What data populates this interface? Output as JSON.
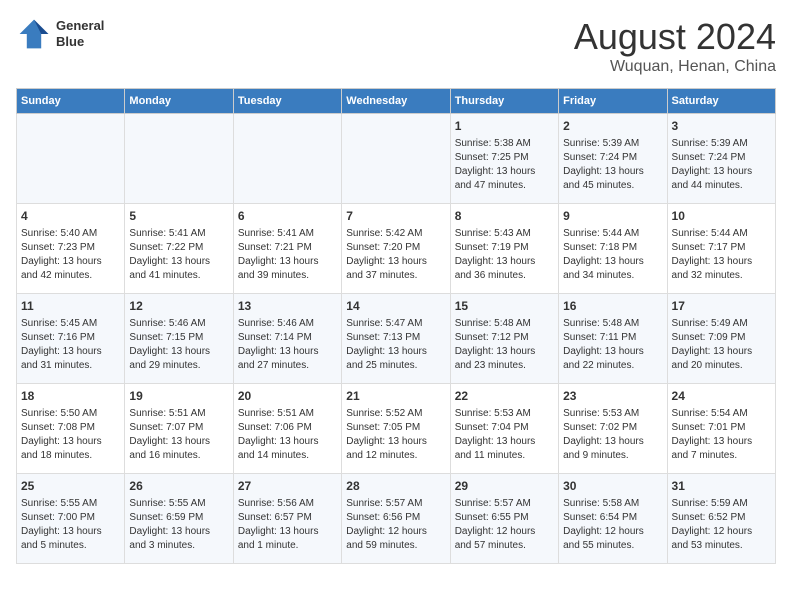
{
  "header": {
    "logo_line1": "General",
    "logo_line2": "Blue",
    "main_title": "August 2024",
    "subtitle": "Wuquan, Henan, China"
  },
  "days_of_week": [
    "Sunday",
    "Monday",
    "Tuesday",
    "Wednesday",
    "Thursday",
    "Friday",
    "Saturday"
  ],
  "weeks": [
    [
      {
        "day": "",
        "info": ""
      },
      {
        "day": "",
        "info": ""
      },
      {
        "day": "",
        "info": ""
      },
      {
        "day": "",
        "info": ""
      },
      {
        "day": "1",
        "info": "Sunrise: 5:38 AM\nSunset: 7:25 PM\nDaylight: 13 hours\nand 47 minutes."
      },
      {
        "day": "2",
        "info": "Sunrise: 5:39 AM\nSunset: 7:24 PM\nDaylight: 13 hours\nand 45 minutes."
      },
      {
        "day": "3",
        "info": "Sunrise: 5:39 AM\nSunset: 7:24 PM\nDaylight: 13 hours\nand 44 minutes."
      }
    ],
    [
      {
        "day": "4",
        "info": "Sunrise: 5:40 AM\nSunset: 7:23 PM\nDaylight: 13 hours\nand 42 minutes."
      },
      {
        "day": "5",
        "info": "Sunrise: 5:41 AM\nSunset: 7:22 PM\nDaylight: 13 hours\nand 41 minutes."
      },
      {
        "day": "6",
        "info": "Sunrise: 5:41 AM\nSunset: 7:21 PM\nDaylight: 13 hours\nand 39 minutes."
      },
      {
        "day": "7",
        "info": "Sunrise: 5:42 AM\nSunset: 7:20 PM\nDaylight: 13 hours\nand 37 minutes."
      },
      {
        "day": "8",
        "info": "Sunrise: 5:43 AM\nSunset: 7:19 PM\nDaylight: 13 hours\nand 36 minutes."
      },
      {
        "day": "9",
        "info": "Sunrise: 5:44 AM\nSunset: 7:18 PM\nDaylight: 13 hours\nand 34 minutes."
      },
      {
        "day": "10",
        "info": "Sunrise: 5:44 AM\nSunset: 7:17 PM\nDaylight: 13 hours\nand 32 minutes."
      }
    ],
    [
      {
        "day": "11",
        "info": "Sunrise: 5:45 AM\nSunset: 7:16 PM\nDaylight: 13 hours\nand 31 minutes."
      },
      {
        "day": "12",
        "info": "Sunrise: 5:46 AM\nSunset: 7:15 PM\nDaylight: 13 hours\nand 29 minutes."
      },
      {
        "day": "13",
        "info": "Sunrise: 5:46 AM\nSunset: 7:14 PM\nDaylight: 13 hours\nand 27 minutes."
      },
      {
        "day": "14",
        "info": "Sunrise: 5:47 AM\nSunset: 7:13 PM\nDaylight: 13 hours\nand 25 minutes."
      },
      {
        "day": "15",
        "info": "Sunrise: 5:48 AM\nSunset: 7:12 PM\nDaylight: 13 hours\nand 23 minutes."
      },
      {
        "day": "16",
        "info": "Sunrise: 5:48 AM\nSunset: 7:11 PM\nDaylight: 13 hours\nand 22 minutes."
      },
      {
        "day": "17",
        "info": "Sunrise: 5:49 AM\nSunset: 7:09 PM\nDaylight: 13 hours\nand 20 minutes."
      }
    ],
    [
      {
        "day": "18",
        "info": "Sunrise: 5:50 AM\nSunset: 7:08 PM\nDaylight: 13 hours\nand 18 minutes."
      },
      {
        "day": "19",
        "info": "Sunrise: 5:51 AM\nSunset: 7:07 PM\nDaylight: 13 hours\nand 16 minutes."
      },
      {
        "day": "20",
        "info": "Sunrise: 5:51 AM\nSunset: 7:06 PM\nDaylight: 13 hours\nand 14 minutes."
      },
      {
        "day": "21",
        "info": "Sunrise: 5:52 AM\nSunset: 7:05 PM\nDaylight: 13 hours\nand 12 minutes."
      },
      {
        "day": "22",
        "info": "Sunrise: 5:53 AM\nSunset: 7:04 PM\nDaylight: 13 hours\nand 11 minutes."
      },
      {
        "day": "23",
        "info": "Sunrise: 5:53 AM\nSunset: 7:02 PM\nDaylight: 13 hours\nand 9 minutes."
      },
      {
        "day": "24",
        "info": "Sunrise: 5:54 AM\nSunset: 7:01 PM\nDaylight: 13 hours\nand 7 minutes."
      }
    ],
    [
      {
        "day": "25",
        "info": "Sunrise: 5:55 AM\nSunset: 7:00 PM\nDaylight: 13 hours\nand 5 minutes."
      },
      {
        "day": "26",
        "info": "Sunrise: 5:55 AM\nSunset: 6:59 PM\nDaylight: 13 hours\nand 3 minutes."
      },
      {
        "day": "27",
        "info": "Sunrise: 5:56 AM\nSunset: 6:57 PM\nDaylight: 13 hours\nand 1 minute."
      },
      {
        "day": "28",
        "info": "Sunrise: 5:57 AM\nSunset: 6:56 PM\nDaylight: 12 hours\nand 59 minutes."
      },
      {
        "day": "29",
        "info": "Sunrise: 5:57 AM\nSunset: 6:55 PM\nDaylight: 12 hours\nand 57 minutes."
      },
      {
        "day": "30",
        "info": "Sunrise: 5:58 AM\nSunset: 6:54 PM\nDaylight: 12 hours\nand 55 minutes."
      },
      {
        "day": "31",
        "info": "Sunrise: 5:59 AM\nSunset: 6:52 PM\nDaylight: 12 hours\nand 53 minutes."
      }
    ]
  ]
}
